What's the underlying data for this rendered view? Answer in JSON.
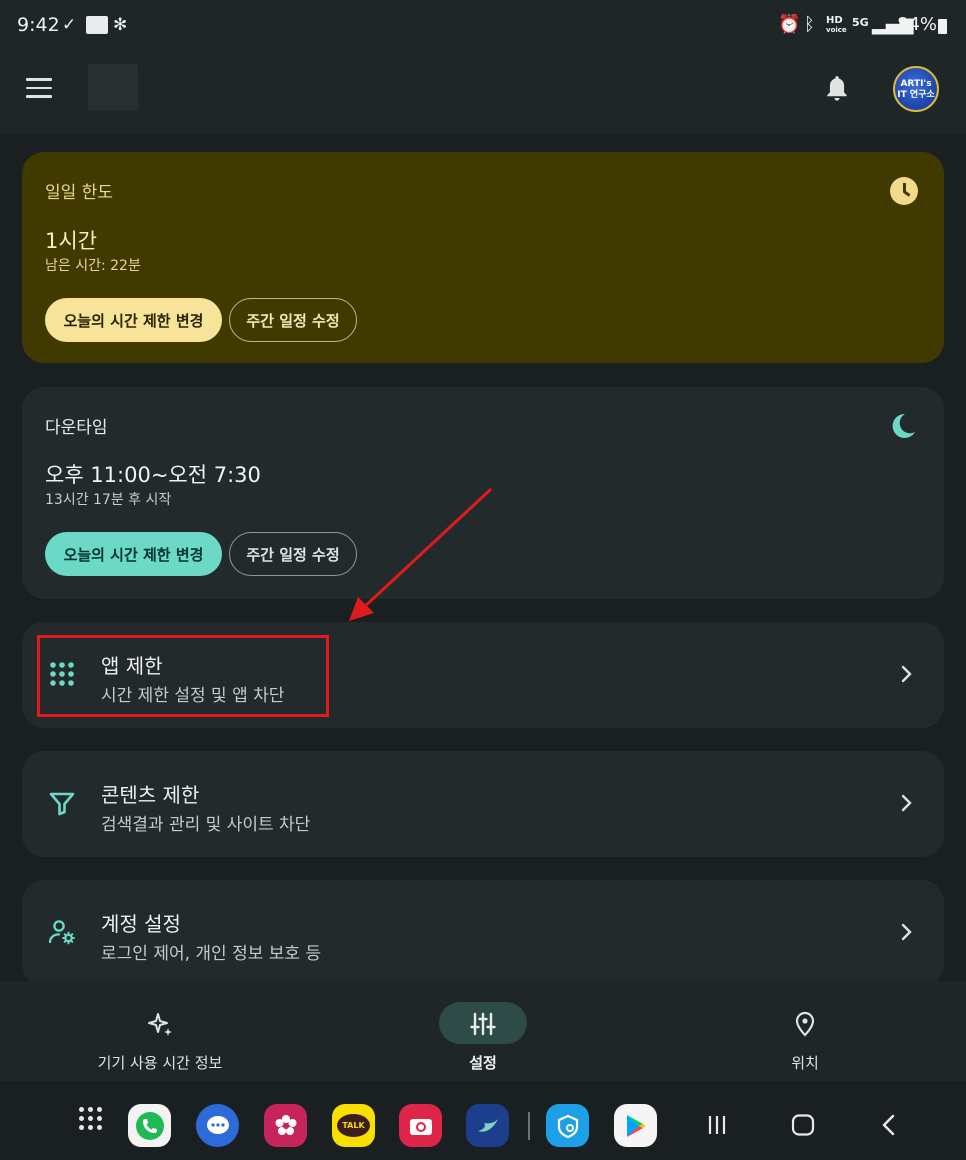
{
  "status_bar": {
    "time": "9:42",
    "battery": "84%",
    "network": "5G",
    "hd_label": "HD",
    "hd_sub": "voice"
  },
  "app_bar": {
    "avatar_text_line1": "ARTI's",
    "avatar_text_line2": "IT 연구소"
  },
  "daily_limit": {
    "title": "일일 한도",
    "value": "1시간",
    "remaining": "남은 시간: 22분",
    "primary_button": "오늘의 시간 제한 변경",
    "secondary_button": "주간 일정 수정",
    "accent_color": "#413a00"
  },
  "downtime": {
    "title": "다운타임",
    "value": "오후 11:00~오전 7:30",
    "subtitle": "13시간 17분 후 시작",
    "primary_button": "오늘의 시간 제한 변경",
    "secondary_button": "주간 일정 수정",
    "accent_color": "#6cd8c6"
  },
  "settings_rows": [
    {
      "title": "앱 제한",
      "subtitle": "시간 제한 설정 및 앱 차단",
      "icon": "apps-grid-icon"
    },
    {
      "title": "콘텐츠 제한",
      "subtitle": "검색결과 관리 및 사이트 차단",
      "icon": "filter-icon"
    },
    {
      "title": "계정 설정",
      "subtitle": "로그인 제어, 개인 정보 보호 등",
      "icon": "account-settings-icon"
    }
  ],
  "bottom_nav": [
    {
      "label": "기기 사용 시간 정보",
      "icon": "sparkle-icon",
      "active": false
    },
    {
      "label": "설정",
      "icon": "tune-icon",
      "active": true
    },
    {
      "label": "위치",
      "icon": "location-pin-icon",
      "active": false
    }
  ],
  "dock": {
    "kakao_label": "TALK"
  },
  "annotation": {
    "highlight_color": "#e01b1b"
  }
}
